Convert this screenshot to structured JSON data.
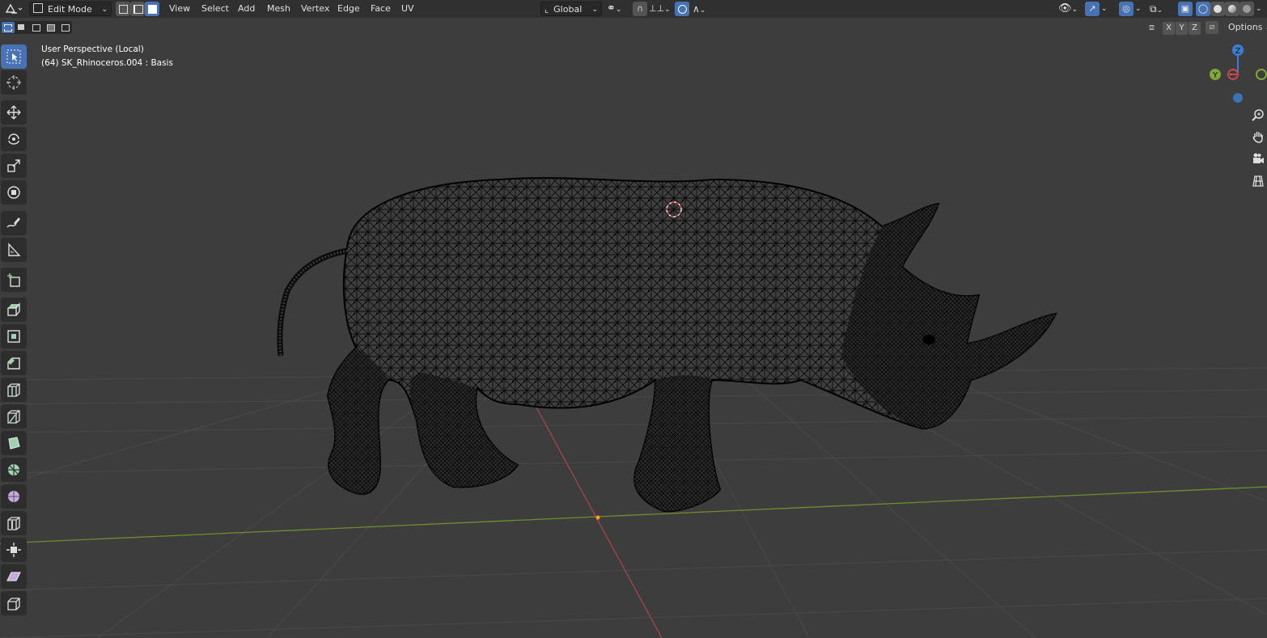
{
  "header": {
    "mode": "Edit Mode",
    "menus": [
      "View",
      "Select",
      "Add",
      "Mesh",
      "Vertex",
      "Edge",
      "Face",
      "UV"
    ],
    "transform_orientation": "Global",
    "options_label": "Options"
  },
  "axis_lock": [
    "X",
    "Y",
    "Z"
  ],
  "viewport": {
    "view_name": "User Perspective (Local)",
    "object_info": "(64) SK_Rhinoceros.004 : Basis"
  },
  "gizmo": {
    "z_label": "Z",
    "y_label": "Y"
  },
  "tools": [
    {
      "icon": "select-box-icon",
      "active": true
    },
    {
      "icon": "cursor-icon"
    },
    {
      "icon": "move-icon"
    },
    {
      "icon": "rotate-icon"
    },
    {
      "icon": "scale-icon"
    },
    {
      "icon": "transform-icon"
    },
    {
      "icon": "annotate-icon"
    },
    {
      "icon": "measure-icon"
    },
    {
      "icon": "add-cube-icon"
    },
    {
      "icon": "extrude-region-icon"
    },
    {
      "icon": "inset-faces-icon"
    },
    {
      "icon": "bevel-icon"
    },
    {
      "icon": "loop-cut-icon"
    },
    {
      "icon": "knife-icon"
    },
    {
      "icon": "poly-build-icon"
    },
    {
      "icon": "spin-icon"
    },
    {
      "icon": "smooth-icon"
    },
    {
      "icon": "edge-slide-icon"
    },
    {
      "icon": "shrink-fatten-icon"
    },
    {
      "icon": "shear-icon"
    },
    {
      "icon": "rip-region-icon"
    }
  ],
  "colors": {
    "accent": "#4772b3",
    "x_axis": "#c9454f",
    "y_axis": "#7ea83a",
    "z_axis": "#3a7fd6",
    "viewport_bg": "#3d3d3d",
    "wireframe": "#050505"
  }
}
